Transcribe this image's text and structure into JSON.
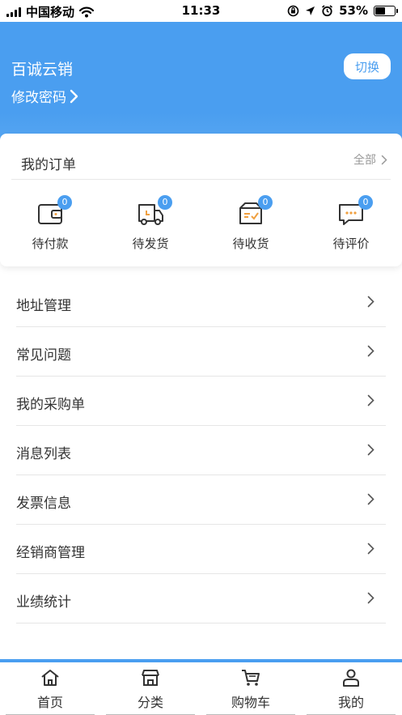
{
  "status_bar": {
    "carrier": "中国移动",
    "time": "11:33",
    "battery": "53%"
  },
  "header": {
    "account_name": "百诚云销",
    "change_password": "修改密码",
    "switch_label": "切换"
  },
  "orders": {
    "title": "我的订单",
    "view_all": "全部",
    "items": [
      {
        "label": "待付款",
        "count": "0",
        "icon": "wallet-icon"
      },
      {
        "label": "待发货",
        "count": "0",
        "icon": "truck-icon"
      },
      {
        "label": "待收货",
        "count": "0",
        "icon": "package-icon"
      },
      {
        "label": "待评价",
        "count": "0",
        "icon": "comment-icon"
      }
    ]
  },
  "menu": [
    {
      "label": "地址管理"
    },
    {
      "label": "常见问题"
    },
    {
      "label": "我的采购单"
    },
    {
      "label": "消息列表"
    },
    {
      "label": "发票信息"
    },
    {
      "label": "经销商管理"
    },
    {
      "label": "业绩统计"
    }
  ],
  "tabbar": [
    {
      "label": "首页",
      "icon": "home-icon"
    },
    {
      "label": "分类",
      "icon": "store-icon"
    },
    {
      "label": "购物车",
      "icon": "cart-icon"
    },
    {
      "label": "我的",
      "icon": "user-icon"
    }
  ],
  "colors": {
    "primary": "#4a9ef0",
    "text": "#333333",
    "muted": "#999999"
  }
}
